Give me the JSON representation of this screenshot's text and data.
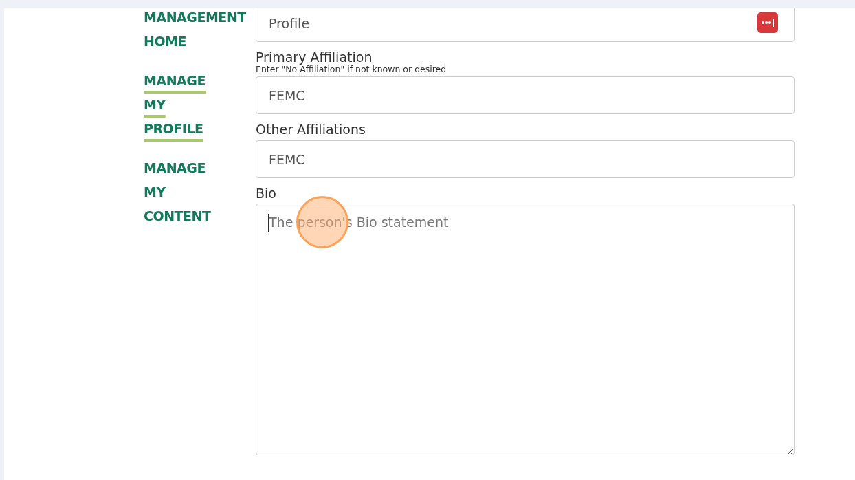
{
  "sidebar": {
    "items": [
      {
        "label": "MANAGEMENT HOME",
        "selected": false
      },
      {
        "label": "MANAGE MY PROFILE",
        "selected": true
      },
      {
        "label": "MANAGE MY CONTENT",
        "selected": false
      }
    ]
  },
  "form": {
    "fields": [
      {
        "kind": "input",
        "value": "Profile",
        "password_icon": true
      },
      {
        "kind": "input",
        "label": "Primary Affiliation",
        "hint": "Enter \"No Affiliation\" if not known or desired",
        "value": "FEMC"
      },
      {
        "kind": "input",
        "label": "Other Affiliations",
        "value": "FEMC"
      },
      {
        "kind": "textarea",
        "label": "Bio",
        "placeholder": "The person's Bio statement",
        "focused": true
      }
    ]
  }
}
